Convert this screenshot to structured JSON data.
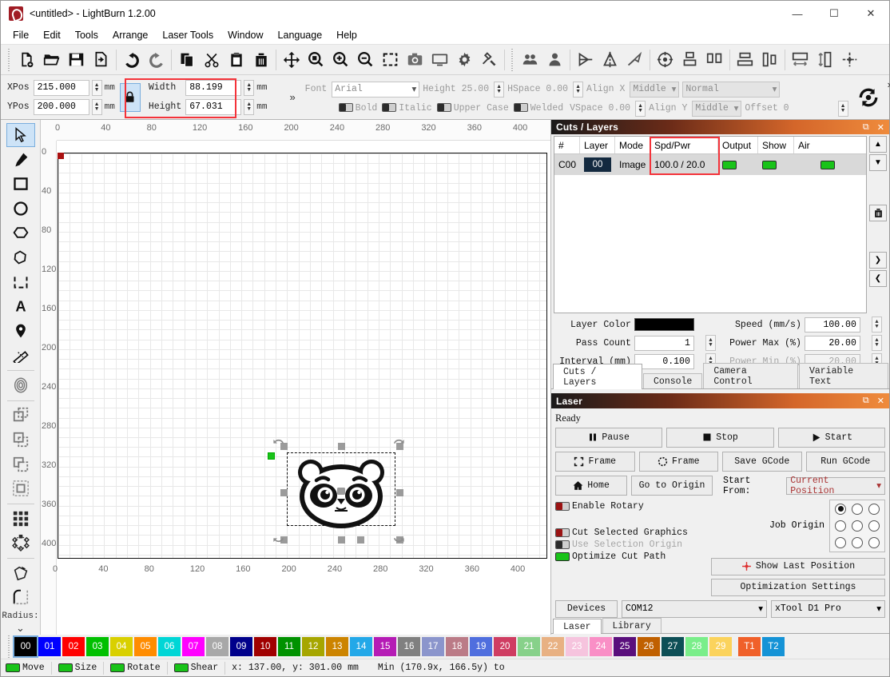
{
  "window": {
    "title": "<untitled> - LightBurn 1.2.00",
    "minimize": "—",
    "maximize": "☐",
    "close": "✕"
  },
  "menu": [
    {
      "label": "File"
    },
    {
      "label": "Edit"
    },
    {
      "label": "Tools"
    },
    {
      "label": "Arrange"
    },
    {
      "label": "Laser Tools"
    },
    {
      "label": "Window"
    },
    {
      "label": "Language"
    },
    {
      "label": "Help"
    }
  ],
  "toolbar_icons": [
    "new-file-icon",
    "open-file-icon",
    "save-file-icon",
    "export-file-icon",
    "undo-icon",
    "redo-icon",
    "copy-icon",
    "cut-icon",
    "paste-icon",
    "delete-icon",
    "move-icon",
    "zoom-fit-icon",
    "zoom-in-icon",
    "zoom-out-icon",
    "frame-select-icon",
    "camera-icon",
    "preview-icon",
    "settings-gear-icon",
    "device-settings-icon",
    "group-icon",
    "ungroup-icon",
    "flip-horizontal-icon",
    "flip-vertical-icon",
    "rotate-icon",
    "align-center-icon",
    "align-group-icon",
    "align-spread-icon",
    "distribute-h-icon",
    "distribute-v-icon",
    "spread-horizontal-icon",
    "spread-vertical-icon",
    "center-page-icon"
  ],
  "properties": {
    "xpos_label": "XPos",
    "xpos_value": "215.000",
    "xpos_unit": "mm",
    "ypos_label": "YPos",
    "ypos_value": "200.000",
    "ypos_unit": "mm",
    "lock_icon": "lock-icon",
    "width_label": "Width",
    "width_value": "88.199",
    "width_unit": "mm",
    "height_label": "Height",
    "height_value": "67.031",
    "height_unit": "mm",
    "expand": "»",
    "highlight_color": "#f4333a"
  },
  "text_props": {
    "font_label": "Font",
    "font_value": "Arial",
    "height_label": "Height 25.00",
    "hspace_label": "HSpace 0.00",
    "vspace_label": "VSpace 0.00",
    "bold_label": "Bold",
    "italic_label": "Italic",
    "uppercase_label": "Upper Case",
    "welded_label": "Welded",
    "alignx_label": "Align X",
    "alignx_value": "Middle",
    "aligny_label": "Align Y",
    "aligny_value": "Middle",
    "style_value": "Normal",
    "offset_label": "Offset 0",
    "expand": "»"
  },
  "tools": [
    {
      "name": "select-tool",
      "icon": "cursor-arrow-icon",
      "active": true
    },
    {
      "name": "draw-line-tool",
      "icon": "pencil-icon",
      "active": false
    },
    {
      "name": "rectangle-tool",
      "icon": "rectangle-icon",
      "active": false
    },
    {
      "name": "ellipse-tool",
      "icon": "ellipse-icon",
      "active": false
    },
    {
      "name": "polygon-tool",
      "icon": "polygon-icon",
      "active": false
    },
    {
      "name": "closed-shape-tool",
      "icon": "blob-shape-icon",
      "active": false
    },
    {
      "name": "boolean-tool",
      "icon": "dashed-rect-icon",
      "active": false
    },
    {
      "name": "text-tool",
      "icon": "letter-a-icon",
      "active": false
    },
    {
      "name": "position-tool",
      "icon": "map-pin-icon",
      "active": false
    },
    {
      "name": "measure-tool",
      "icon": "ruler-icon",
      "active": false
    },
    {
      "name": "offset-tool",
      "icon": "offset-rings-icon",
      "active": false
    },
    {
      "name": "boolean-union-tool",
      "icon": "bool-union-icon",
      "active": false
    },
    {
      "name": "boolean-subtract-tool",
      "icon": "bool-subtract-icon",
      "active": false
    },
    {
      "name": "boolean-intersect-tool",
      "icon": "bool-intersect-icon",
      "active": false
    },
    {
      "name": "boolean-cut-tool",
      "icon": "bool-cut-icon",
      "active": false
    },
    {
      "name": "grid-array-tool",
      "icon": "grid-array-icon",
      "active": false
    },
    {
      "name": "circular-array-tool",
      "icon": "circular-array-icon",
      "active": false
    },
    {
      "name": "edit-nodes-tool",
      "icon": "edit-nodes-icon",
      "active": false
    },
    {
      "name": "radius-tool",
      "icon": "corner-radius-icon",
      "active": false
    }
  ],
  "tool_extra": {
    "radius_label": "Radius:",
    "more": "⌄"
  },
  "canvas": {
    "ruler_h_ticks": [
      "0",
      "40",
      "80",
      "120",
      "160",
      "200",
      "240",
      "280",
      "320",
      "360",
      "400"
    ],
    "ruler_v_ticks": [
      "0",
      "40",
      "80",
      "120",
      "160",
      "200",
      "240",
      "280",
      "320",
      "360",
      "400"
    ],
    "workarea_label_right": [
      "0",
      "40",
      "80",
      "120",
      "160",
      "200",
      "240",
      "280",
      "320",
      "360",
      "400"
    ],
    "origin_marker": "origin-marker"
  },
  "cuts_panel": {
    "title": "Cuts / Layers",
    "float_icon": "float-panel-icon",
    "close_icon": "close-panel-icon",
    "columns": [
      "#",
      "Layer",
      "Mode",
      "Spd/Pwr",
      "Output",
      "Show",
      "Air"
    ],
    "rows": [
      {
        "num": "C00",
        "layer": "00",
        "mode": "Image",
        "spdpwr": "100.0 / 20.0",
        "output": true,
        "show": true,
        "air": true
      }
    ],
    "spdpwr_highlight": "#f4333a",
    "side_buttons": [
      "move-up-icon",
      "move-down-icon",
      "delete-layer-icon",
      "move-right-icon",
      "move-left-icon"
    ],
    "props": {
      "layer_color_label": "Layer Color",
      "layer_color_value": "#000000",
      "speed_label": "Speed (mm/s)",
      "speed_value": "100.00",
      "pass_count_label": "Pass Count",
      "pass_count_value": "1",
      "power_max_label": "Power Max (%)",
      "power_max_value": "20.00",
      "interval_label": "Interval (mm)",
      "interval_value": "0.100",
      "power_min_label": "Power Min (%)",
      "power_min_value": "20.00"
    },
    "tabs": [
      {
        "label": "Cuts / Layers",
        "active": true
      },
      {
        "label": "Console",
        "active": false
      },
      {
        "label": "Camera Control",
        "active": false
      },
      {
        "label": "Variable Text",
        "active": false
      }
    ]
  },
  "laser_panel": {
    "title": "Laser",
    "float_icon": "float-panel-icon",
    "close_icon": "close-panel-icon",
    "status": "Ready",
    "pause": "Pause",
    "stop": "Stop",
    "start": "Start",
    "frame_square": "Frame",
    "frame_round": "Frame",
    "save_gcode": "Save GCode",
    "run_gcode": "Run GCode",
    "home": "Home",
    "go_to_origin": "Go to Origin",
    "start_from_label": "Start From:",
    "start_from_value": "Current Position",
    "enable_rotary": "Enable Rotary",
    "cut_selected": "Cut Selected Graphics",
    "use_selection_origin": "Use Selection Origin",
    "optimize_cut_path": "Optimize Cut Path",
    "job_origin_label": "Job Origin",
    "job_origin_selected_index": 0,
    "show_last_position": "Show Last Position",
    "optimization_settings": "Optimization Settings",
    "devices_button": "Devices",
    "port_value": "COM12",
    "device_value": "xTool D1 Pro",
    "tabs": [
      {
        "label": "Laser",
        "active": true
      },
      {
        "label": "Library",
        "active": false
      }
    ]
  },
  "palette": [
    {
      "label": "00",
      "color": "#000000",
      "selected": true
    },
    {
      "label": "01",
      "color": "#0000ff"
    },
    {
      "label": "02",
      "color": "#ff0000"
    },
    {
      "label": "03",
      "color": "#00c000"
    },
    {
      "label": "04",
      "color": "#d9d000"
    },
    {
      "label": "05",
      "color": "#ff8c00"
    },
    {
      "label": "06",
      "color": "#00d6d6"
    },
    {
      "label": "07",
      "color": "#ff00ff"
    },
    {
      "label": "08",
      "color": "#a8a8a8"
    },
    {
      "label": "09",
      "color": "#00008b"
    },
    {
      "label": "10",
      "color": "#a00000"
    },
    {
      "label": "11",
      "color": "#009200"
    },
    {
      "label": "12",
      "color": "#a6a600"
    },
    {
      "label": "13",
      "color": "#cc8400"
    },
    {
      "label": "14",
      "color": "#23a8e8"
    },
    {
      "label": "15",
      "color": "#b51bb5"
    },
    {
      "label": "16",
      "color": "#808080"
    },
    {
      "label": "17",
      "color": "#8b95cc"
    },
    {
      "label": "18",
      "color": "#bb7b87"
    },
    {
      "label": "19",
      "color": "#4f6ede"
    },
    {
      "label": "20",
      "color": "#cf3d62"
    },
    {
      "label": "21",
      "color": "#87d18a"
    },
    {
      "label": "22",
      "color": "#e8b183"
    },
    {
      "label": "23",
      "color": "#f6c4de"
    },
    {
      "label": "24",
      "color": "#f98fc6"
    },
    {
      "label": "25",
      "color": "#5a0f7c"
    },
    {
      "label": "26",
      "color": "#c06000"
    },
    {
      "label": "27",
      "color": "#0d4f56"
    },
    {
      "label": "28",
      "color": "#7aee8a"
    },
    {
      "label": "29",
      "color": "#fbd35c"
    },
    {
      "label": "T1",
      "color": "#f0602a"
    },
    {
      "label": "T2",
      "color": "#1593d6"
    }
  ],
  "statusbar": {
    "move_label": "Move",
    "size_label": "Size",
    "rotate_label": "Rotate",
    "shear_label": "Shear",
    "coords": "x: 137.00, y: 301.00 mm",
    "bounds": "Min (170.9x, 166.5y) to"
  }
}
